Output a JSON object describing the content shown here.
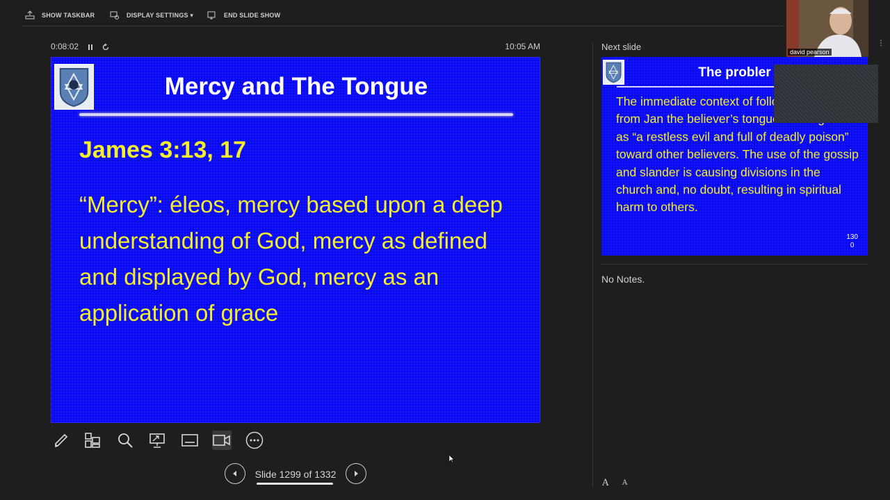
{
  "toolbar": {
    "show_taskbar": "SHOW TASKBAR",
    "display_settings": "DISPLAY SETTINGS ▾",
    "end_slide_show": "END SLIDE SHOW"
  },
  "status": {
    "elapsed": "0:08:02",
    "clock": "10:05 AM"
  },
  "current_slide": {
    "title": "Mercy and The Tongue",
    "reference": "James 3:13, 17",
    "body": "“Mercy”: éleos, mercy based upon a deep understanding of God, mercy as defined and displayed by God, mercy as an application of grace"
  },
  "navigation": {
    "counter": "Slide 1299 of 1332"
  },
  "next_slide": {
    "label": "Next slide",
    "title": "The probler",
    "body": "The immediate context of following passage from Jan the believer’s tongue is being used as “a restless evil and full of deadly poison” toward other believers. The use of the gossip and slander is causing divisions in the church and, no doubt, resulting in spiritual harm to others.",
    "number_top": "130",
    "number_bottom": "0"
  },
  "notes": {
    "text": "No Notes."
  },
  "video": {
    "participant_name": "david pearson"
  },
  "font_controls": {
    "increase": "A",
    "decrease": "A"
  },
  "icons": {
    "tools": [
      "pen-icon",
      "see-all-slides-icon",
      "zoom-icon",
      "pointer-options-icon",
      "subtitles-icon",
      "camera-icon",
      "more-options-icon"
    ]
  },
  "colors": {
    "slide_background": "#0a0af2",
    "slide_text": "#f4ef2a",
    "app_background": "#1e1e1e"
  }
}
